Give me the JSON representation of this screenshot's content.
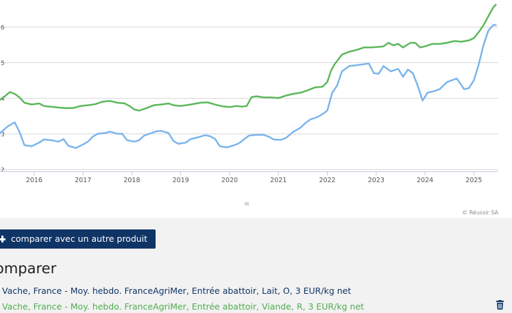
{
  "chart_data": {
    "type": "line",
    "y_ticks": [
      2,
      3,
      4,
      5,
      6
    ],
    "ylim": [
      1.95,
      6.75
    ],
    "x_ticks": [
      "2016",
      "2017",
      "2018",
      "2019",
      "2020",
      "2021",
      "2022",
      "2023",
      "2024",
      "2025"
    ],
    "xlim": [
      2015.3,
      2025.5
    ],
    "grid": true,
    "watermark": "© Réussir SA",
    "series": [
      {
        "name": "Vache, France - Moy. hebdo. FranceAgriMer, Entrée abattoir, Lait, O, 3 EUR/kg net",
        "color": "#7cb5ec",
        "points": [
          [
            2015.3,
            3.02
          ],
          [
            2015.45,
            3.2
          ],
          [
            2015.6,
            3.32
          ],
          [
            2015.7,
            3.05
          ],
          [
            2015.8,
            2.68
          ],
          [
            2015.95,
            2.65
          ],
          [
            2016.1,
            2.75
          ],
          [
            2016.2,
            2.84
          ],
          [
            2016.35,
            2.82
          ],
          [
            2016.5,
            2.78
          ],
          [
            2016.6,
            2.85
          ],
          [
            2016.7,
            2.66
          ],
          [
            2016.85,
            2.6
          ],
          [
            2017.0,
            2.7
          ],
          [
            2017.1,
            2.78
          ],
          [
            2017.2,
            2.92
          ],
          [
            2017.3,
            3.0
          ],
          [
            2017.45,
            3.02
          ],
          [
            2017.55,
            3.06
          ],
          [
            2017.7,
            3.0
          ],
          [
            2017.8,
            3.0
          ],
          [
            2017.9,
            2.82
          ],
          [
            2018.05,
            2.78
          ],
          [
            2018.15,
            2.82
          ],
          [
            2018.25,
            2.95
          ],
          [
            2018.4,
            3.02
          ],
          [
            2018.5,
            3.07
          ],
          [
            2018.6,
            3.08
          ],
          [
            2018.75,
            3.02
          ],
          [
            2018.85,
            2.8
          ],
          [
            2018.95,
            2.72
          ],
          [
            2019.1,
            2.75
          ],
          [
            2019.2,
            2.85
          ],
          [
            2019.35,
            2.9
          ],
          [
            2019.5,
            2.96
          ],
          [
            2019.6,
            2.93
          ],
          [
            2019.7,
            2.86
          ],
          [
            2019.8,
            2.65
          ],
          [
            2019.95,
            2.62
          ],
          [
            2020.1,
            2.68
          ],
          [
            2020.2,
            2.74
          ],
          [
            2020.3,
            2.85
          ],
          [
            2020.4,
            2.95
          ],
          [
            2020.55,
            2.97
          ],
          [
            2020.7,
            2.97
          ],
          [
            2020.8,
            2.92
          ],
          [
            2020.9,
            2.84
          ],
          [
            2021.05,
            2.83
          ],
          [
            2021.15,
            2.88
          ],
          [
            2021.3,
            3.05
          ],
          [
            2021.45,
            3.17
          ],
          [
            2021.55,
            3.3
          ],
          [
            2021.65,
            3.4
          ],
          [
            2021.8,
            3.47
          ],
          [
            2021.9,
            3.55
          ],
          [
            2022.0,
            3.65
          ],
          [
            2022.1,
            4.15
          ],
          [
            2022.2,
            4.35
          ],
          [
            2022.3,
            4.75
          ],
          [
            2022.45,
            4.9
          ],
          [
            2022.6,
            4.92
          ],
          [
            2022.75,
            4.95
          ],
          [
            2022.85,
            4.97
          ],
          [
            2022.95,
            4.7
          ],
          [
            2023.05,
            4.68
          ],
          [
            2023.15,
            4.9
          ],
          [
            2023.3,
            4.75
          ],
          [
            2023.45,
            4.82
          ],
          [
            2023.55,
            4.6
          ],
          [
            2023.65,
            4.8
          ],
          [
            2023.75,
            4.7
          ],
          [
            2023.85,
            4.35
          ],
          [
            2023.95,
            3.93
          ],
          [
            2024.05,
            4.15
          ],
          [
            2024.2,
            4.2
          ],
          [
            2024.3,
            4.25
          ],
          [
            2024.45,
            4.45
          ],
          [
            2024.55,
            4.5
          ],
          [
            2024.65,
            4.55
          ],
          [
            2024.8,
            4.25
          ],
          [
            2024.9,
            4.28
          ],
          [
            2025.0,
            4.5
          ],
          [
            2025.1,
            4.95
          ],
          [
            2025.2,
            5.5
          ],
          [
            2025.3,
            5.9
          ],
          [
            2025.4,
            6.05
          ],
          [
            2025.45,
            6.05
          ]
        ]
      },
      {
        "name": "Vache, France - Moy. hebdo. FranceAgriMer, Entrée abattoir, Viande, R, 3 EUR/kg net",
        "color": "#5cb85c",
        "points": [
          [
            2015.3,
            3.95
          ],
          [
            2015.4,
            4.05
          ],
          [
            2015.5,
            4.17
          ],
          [
            2015.6,
            4.12
          ],
          [
            2015.7,
            4.02
          ],
          [
            2015.8,
            3.87
          ],
          [
            2015.95,
            3.82
          ],
          [
            2016.1,
            3.85
          ],
          [
            2016.2,
            3.78
          ],
          [
            2016.4,
            3.75
          ],
          [
            2016.6,
            3.72
          ],
          [
            2016.8,
            3.72
          ],
          [
            2016.95,
            3.78
          ],
          [
            2017.1,
            3.8
          ],
          [
            2017.25,
            3.83
          ],
          [
            2017.4,
            3.9
          ],
          [
            2017.55,
            3.92
          ],
          [
            2017.7,
            3.87
          ],
          [
            2017.85,
            3.85
          ],
          [
            2017.95,
            3.78
          ],
          [
            2018.05,
            3.68
          ],
          [
            2018.15,
            3.65
          ],
          [
            2018.3,
            3.72
          ],
          [
            2018.45,
            3.8
          ],
          [
            2018.6,
            3.82
          ],
          [
            2018.75,
            3.85
          ],
          [
            2018.85,
            3.8
          ],
          [
            2019.0,
            3.78
          ],
          [
            2019.2,
            3.82
          ],
          [
            2019.4,
            3.87
          ],
          [
            2019.55,
            3.88
          ],
          [
            2019.7,
            3.82
          ],
          [
            2019.85,
            3.77
          ],
          [
            2020.0,
            3.75
          ],
          [
            2020.15,
            3.78
          ],
          [
            2020.25,
            3.76
          ],
          [
            2020.35,
            3.78
          ],
          [
            2020.45,
            4.03
          ],
          [
            2020.55,
            4.05
          ],
          [
            2020.7,
            4.02
          ],
          [
            2020.85,
            4.02
          ],
          [
            2021.0,
            4.0
          ],
          [
            2021.15,
            4.07
          ],
          [
            2021.3,
            4.12
          ],
          [
            2021.45,
            4.15
          ],
          [
            2021.6,
            4.22
          ],
          [
            2021.75,
            4.3
          ],
          [
            2021.9,
            4.32
          ],
          [
            2022.0,
            4.45
          ],
          [
            2022.08,
            4.78
          ],
          [
            2022.15,
            4.95
          ],
          [
            2022.3,
            5.22
          ],
          [
            2022.45,
            5.3
          ],
          [
            2022.6,
            5.35
          ],
          [
            2022.75,
            5.42
          ],
          [
            2022.9,
            5.42
          ],
          [
            2023.0,
            5.43
          ],
          [
            2023.15,
            5.45
          ],
          [
            2023.25,
            5.55
          ],
          [
            2023.35,
            5.48
          ],
          [
            2023.45,
            5.52
          ],
          [
            2023.55,
            5.42
          ],
          [
            2023.7,
            5.55
          ],
          [
            2023.8,
            5.55
          ],
          [
            2023.9,
            5.42
          ],
          [
            2024.0,
            5.45
          ],
          [
            2024.15,
            5.52
          ],
          [
            2024.3,
            5.52
          ],
          [
            2024.45,
            5.55
          ],
          [
            2024.6,
            5.6
          ],
          [
            2024.75,
            5.58
          ],
          [
            2024.9,
            5.62
          ],
          [
            2025.0,
            5.68
          ],
          [
            2025.1,
            5.85
          ],
          [
            2025.2,
            6.05
          ],
          [
            2025.3,
            6.3
          ],
          [
            2025.4,
            6.55
          ],
          [
            2025.45,
            6.62
          ]
        ]
      }
    ]
  },
  "ui": {
    "scroll_handle_label": "III",
    "compare_button_label": "comparer avec un autre produit",
    "compare_heading": "omparer",
    "products": [
      {
        "label": "Vache, France - Moy. hebdo. FranceAgriMer, Entrée abattoir, Lait, O, 3 EUR/kg net",
        "color": "#0f3466"
      },
      {
        "label": "Vache, France - Moy. hebdo. FranceAgriMer, Entrée abattoir, Viande, R, 3 EUR/kg net",
        "color": "#4fad4f"
      }
    ],
    "icons": {
      "add": "plus-icon",
      "delete": "trash-icon"
    }
  }
}
